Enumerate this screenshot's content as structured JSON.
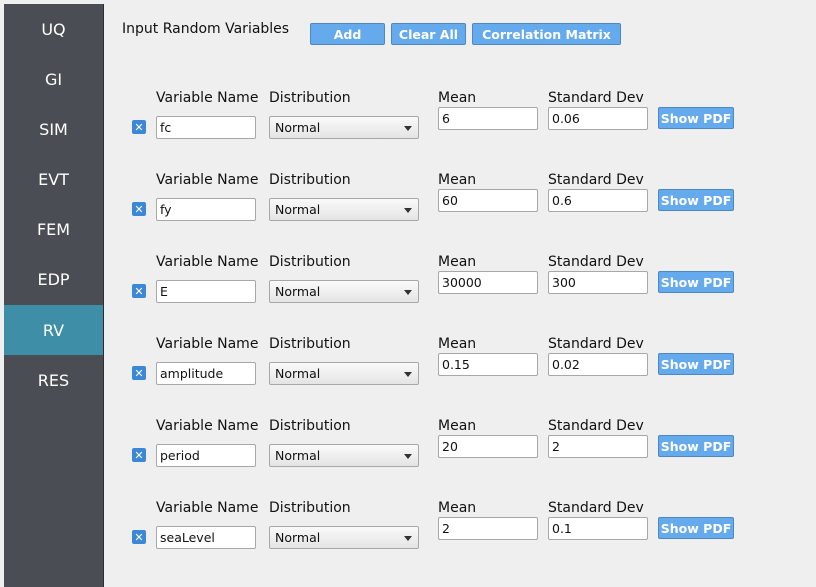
{
  "sidebar": {
    "items": [
      {
        "label": "UQ"
      },
      {
        "label": "GI"
      },
      {
        "label": "SIM"
      },
      {
        "label": "EVT"
      },
      {
        "label": "FEM"
      },
      {
        "label": "EDP"
      },
      {
        "label": "RV"
      },
      {
        "label": "RES"
      }
    ],
    "active": "RV"
  },
  "header": {
    "title": "Input Random Variables",
    "add_label": "Add",
    "clear_all_label": "Clear All",
    "correlation_label": "Correlation Matrix"
  },
  "labels": {
    "variable_name": "Variable Name",
    "distribution": "Distribution",
    "mean": "Mean",
    "std_dev": "Standard Dev",
    "show_pdf": "Show PDF",
    "remove_glyph": "✕"
  },
  "rows": [
    {
      "name": "fc",
      "distribution": "Normal",
      "mean": "6",
      "std": "0.06"
    },
    {
      "name": "fy",
      "distribution": "Normal",
      "mean": "60",
      "std": "0.6"
    },
    {
      "name": "E",
      "distribution": "Normal",
      "mean": "30000",
      "std": "300"
    },
    {
      "name": "amplitude",
      "distribution": "Normal",
      "mean": "0.15",
      "std": "0.02"
    },
    {
      "name": "period",
      "distribution": "Normal",
      "mean": "20",
      "std": "2"
    },
    {
      "name": "seaLevel",
      "distribution": "Normal",
      "mean": "2",
      "std": "0.1"
    }
  ],
  "colors": {
    "sidebar_bg": "#4a4d53",
    "sidebar_active": "#3d8ea6",
    "button_bg": "#66aaee",
    "checkbox": "#3b88d6",
    "page_bg": "#efefef"
  }
}
